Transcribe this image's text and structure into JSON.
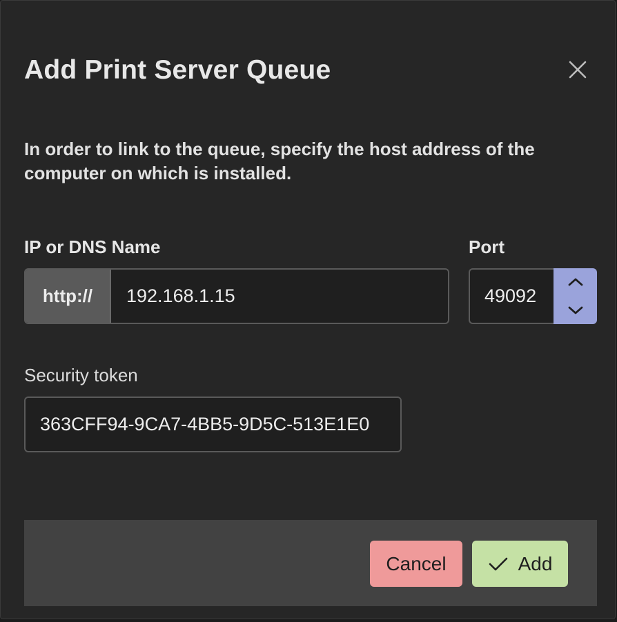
{
  "dialog": {
    "title": "Add Print Server Queue",
    "close_icon": "close-icon",
    "description": "In order to link to the queue, specify the host address of the computer on which is installed."
  },
  "ip": {
    "label": "IP or DNS Name",
    "prefix": "http://",
    "value": "192.168.1.15"
  },
  "port": {
    "label": "Port",
    "value": "49092",
    "up_icon": "chevron-up-icon",
    "down_icon": "chevron-down-icon"
  },
  "token": {
    "label": "Security token",
    "value": "363CFF94-9CA7-4BB5-9D5C-513E1E0"
  },
  "footer": {
    "cancel_label": "Cancel",
    "add_label": "Add",
    "add_icon": "check-icon"
  },
  "colors": {
    "dialog_bg": "#262626",
    "footer_bg": "#424242",
    "cancel_bg": "#ef9a9a",
    "add_bg": "#c5e1a5",
    "stepper_bg": "#9aa3db"
  }
}
